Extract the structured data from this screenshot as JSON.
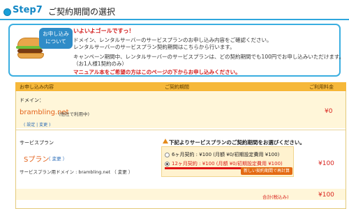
{
  "step": {
    "label": "Step7",
    "title": "ご契約期間の選択"
  },
  "intro": {
    "badge_line1": "お申し込み",
    "badge_line2": "について",
    "headline": "いよいよゴールですっ！",
    "line1": "ドメイン、レンタルサーバーのサービスプランのお申し込み内容をご確認ください。",
    "line2": "レンタルサーバーのサービスプラン契約期間はこちらから行います。",
    "line3": "キャンペーン期間中、レンタルサーバーのサービスプランは、どの契約期間でも100円でお申し込みいただけます。",
    "line4": "（お1人様1契約のみ）",
    "notice": "マニュアル本をご希望の方はこのページの下からお申し込みください。"
  },
  "table": {
    "headers": [
      "お申し込み内容",
      "ご契約期間",
      "ご利用料金"
    ],
    "domain_row": {
      "label": "ドメイン：",
      "domain": "brambling.net",
      "domain_note": "(他社で利用中)",
      "links": "( 設定 | 変更 )",
      "price": "¥0"
    },
    "plan_row": {
      "label": "サービスプラン",
      "plan": "Sプラン",
      "plan_link": "（ 変更 ）",
      "plan_domain": "サービスプラン用ドメイン : brambling.net （ 変更 ）",
      "notice": "下記よりサービスプランのご契約期間をお選びください。",
      "options": [
        {
          "label": "6ヶ月契約 : ¥100 (月額 ¥0/初期設定費用 ¥100)",
          "selected": false
        },
        {
          "label": "12ヶ月契約 : ¥100 (月額 ¥0/初期設定費用 ¥100)",
          "selected": true
        }
      ],
      "recalc_button": "新しい契約期間で再計算",
      "price": "¥100"
    },
    "total": {
      "label": "合計(税込み)",
      "price": "¥100"
    }
  },
  "colors": {
    "accent_blue": "#2ea7dd",
    "header_orange": "#f6b83a",
    "price_red": "#d9241e"
  }
}
